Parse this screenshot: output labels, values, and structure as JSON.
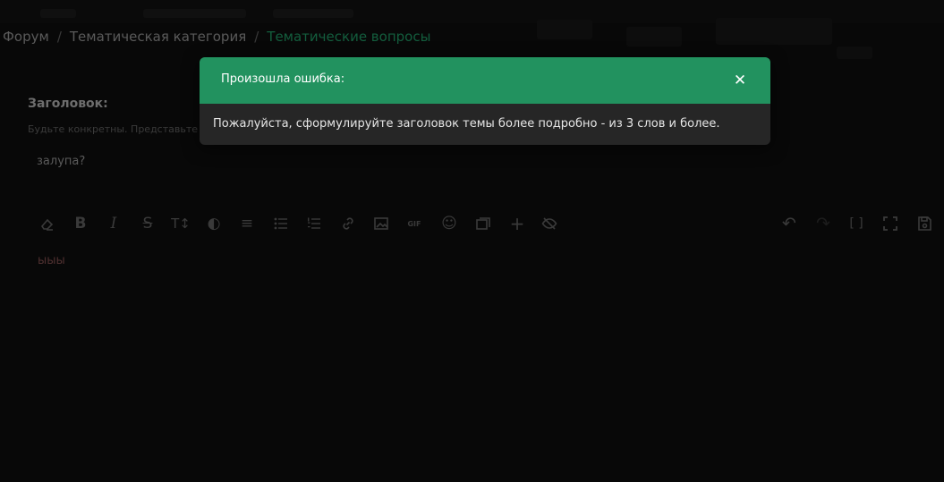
{
  "breadcrumb": {
    "items": [
      "Форум",
      "Тематическая категория"
    ],
    "separator": "/",
    "current": "Тематические вопросы"
  },
  "form": {
    "title_label": "Заголовок:",
    "title_hint": "Будьте конкретны. Представьте",
    "title_value": "залупа?"
  },
  "editor": {
    "body_text": "ыыы",
    "toolbar_left": [
      {
        "name": "eraser-icon"
      },
      {
        "name": "bold-icon",
        "glyph": "B"
      },
      {
        "name": "italic-icon",
        "glyph": "I"
      },
      {
        "name": "strikethrough-icon",
        "glyph": "S"
      },
      {
        "name": "text-size-icon",
        "glyph": "T↕"
      },
      {
        "name": "color-icon",
        "glyph": "◐"
      },
      {
        "name": "align-icon",
        "glyph": "≡"
      },
      {
        "name": "bullet-list-icon"
      },
      {
        "name": "numbered-list-icon"
      },
      {
        "name": "link-icon"
      },
      {
        "name": "image-icon"
      },
      {
        "name": "gif-icon",
        "glyph": "GIF"
      },
      {
        "name": "emoji-icon",
        "glyph": "☺"
      },
      {
        "name": "gallery-icon"
      },
      {
        "name": "plus-icon",
        "glyph": "+"
      },
      {
        "name": "hide-icon"
      }
    ],
    "toolbar_right": [
      {
        "name": "undo-icon",
        "glyph": "↶"
      },
      {
        "name": "redo-icon",
        "glyph": "↷",
        "disabled": true
      },
      {
        "name": "brackets-icon",
        "glyph": "[ ]"
      },
      {
        "name": "fullscreen-icon"
      },
      {
        "name": "save-draft-icon"
      }
    ]
  },
  "modal": {
    "title": "Произошла ошибка:",
    "close_glyph": "✕",
    "message": "Пожалуйста, сформулируйте заголовок темы более подробно - из 3 слов и более."
  },
  "colors": {
    "accent": "#22925f",
    "background": "#0d0d0d",
    "modal_body": "#262626"
  }
}
